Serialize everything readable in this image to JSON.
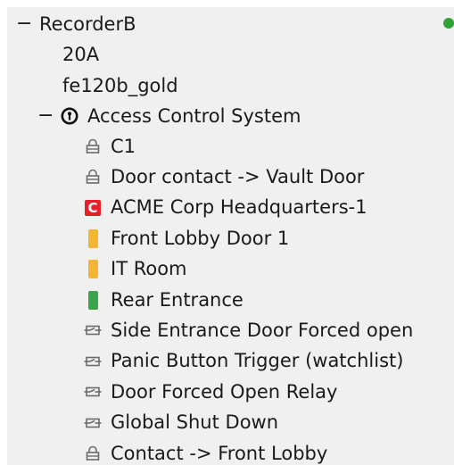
{
  "tree": {
    "recorder": {
      "toggle": "−",
      "label": "RecorderB",
      "status_color": "#2fa336"
    },
    "item_20a": {
      "label": "20A"
    },
    "item_fe120b": {
      "label": "fe120b_gold"
    },
    "acs": {
      "toggle": "−",
      "label": "Access Control System",
      "icon": "access-control-icon"
    },
    "children": [
      {
        "label": "C1",
        "icon": "lock-icon"
      },
      {
        "label": "Door contact -> Vault Door",
        "icon": "lock-icon"
      },
      {
        "label": "ACME Corp Headquarters-1",
        "icon": "alarm-c-icon",
        "badge": "C",
        "color": "#e8202a"
      },
      {
        "label": "Front Lobby Door 1",
        "icon": "door-icon",
        "color": "#f5b431"
      },
      {
        "label": "IT Room",
        "icon": "door-icon",
        "color": "#f5b431"
      },
      {
        "label": "Rear Entrance",
        "icon": "door-icon",
        "color": "#3aa54b"
      },
      {
        "label": "Side Entrance Door Forced open",
        "icon": "relay-icon"
      },
      {
        "label": "Panic Button Trigger (watchlist)",
        "icon": "relay-icon"
      },
      {
        "label": "Door Forced Open Relay",
        "icon": "relay-icon"
      },
      {
        "label": "Global Shut Down",
        "icon": "relay-icon"
      },
      {
        "label": "Contact -> Front Lobby",
        "icon": "lock-icon"
      }
    ]
  }
}
